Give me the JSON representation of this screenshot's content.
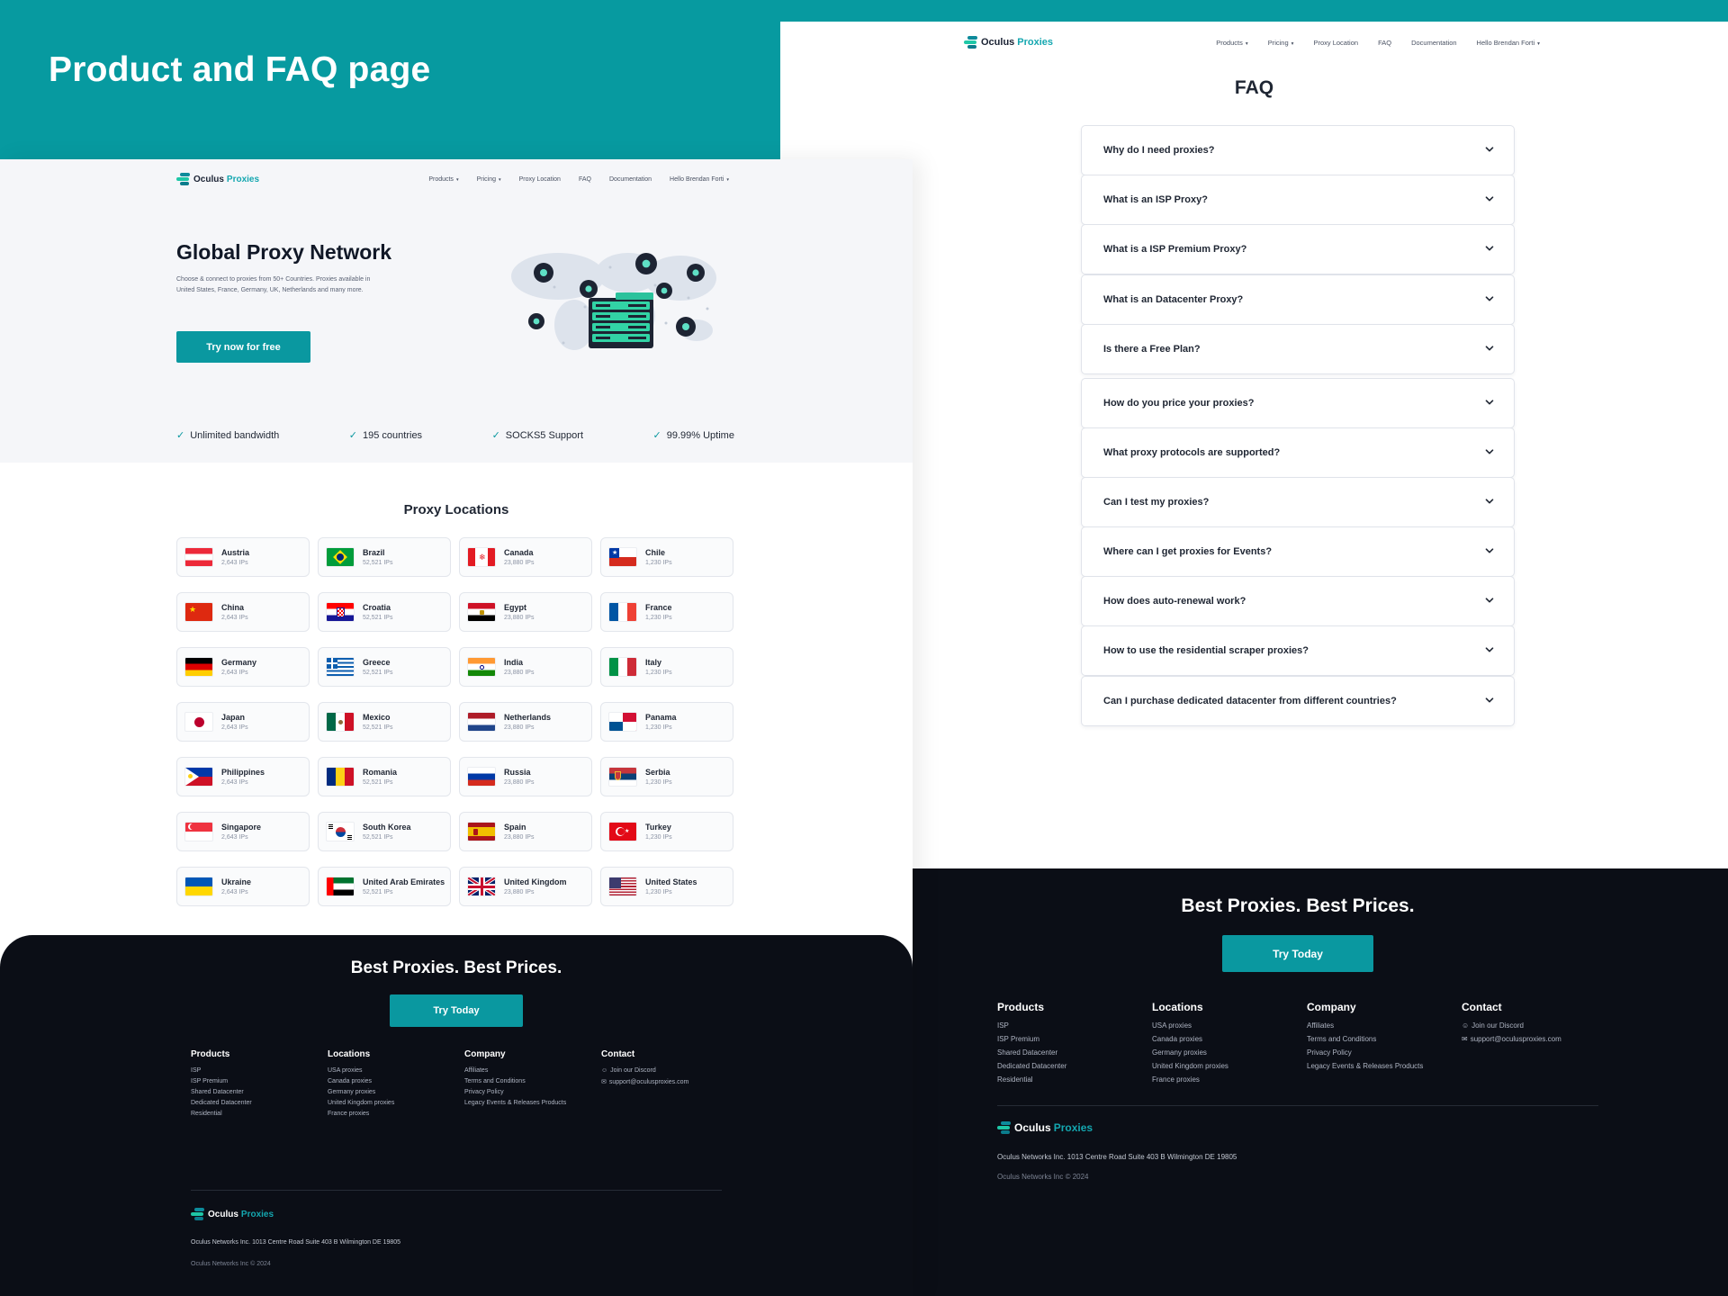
{
  "showcase_title": "Product and FAQ page",
  "colors": {
    "brand_teal": "#079aa0",
    "footer_dark": "#0b0e16",
    "hero_bg": "#f5f6f9"
  },
  "brand": {
    "word_a": "Oculus",
    "word_b": "Proxies"
  },
  "nav": {
    "items": [
      {
        "label": "Products",
        "dropdown": true
      },
      {
        "label": "Pricing",
        "dropdown": true
      },
      {
        "label": "Proxy Location",
        "dropdown": false
      },
      {
        "label": "FAQ",
        "dropdown": false
      },
      {
        "label": "Documentation",
        "dropdown": false
      },
      {
        "label": "Hello Brendan Forti",
        "dropdown": true
      }
    ]
  },
  "hero": {
    "title": "Global Proxy Network",
    "description": "Choose & connect to proxies from 50+ Countries. Proxies available in United States, France, Germany, UK, Netherlands and many more.",
    "cta": "Try now for free"
  },
  "features": [
    "Unlimited bandwidth",
    "195 countries",
    "SOCKS5 Support",
    "99.99% Uptime"
  ],
  "locations": {
    "title": "Proxy Locations",
    "items": [
      {
        "name": "Austria",
        "ips": "2,643 IPs",
        "flag": "austria"
      },
      {
        "name": "Brazil",
        "ips": "52,521 IPs",
        "flag": "brazil"
      },
      {
        "name": "Canada",
        "ips": "23,880 IPs",
        "flag": "canada"
      },
      {
        "name": "Chile",
        "ips": "1,230 IPs",
        "flag": "chile"
      },
      {
        "name": "China",
        "ips": "2,643 IPs",
        "flag": "china"
      },
      {
        "name": "Croatia",
        "ips": "52,521 IPs",
        "flag": "croatia"
      },
      {
        "name": "Egypt",
        "ips": "23,880 IPs",
        "flag": "egypt"
      },
      {
        "name": "France",
        "ips": "1,230 IPs",
        "flag": "france"
      },
      {
        "name": "Germany",
        "ips": "2,643 IPs",
        "flag": "germany"
      },
      {
        "name": "Greece",
        "ips": "52,521 IPs",
        "flag": "greece"
      },
      {
        "name": "India",
        "ips": "23,880 IPs",
        "flag": "india"
      },
      {
        "name": "Italy",
        "ips": "1,230 IPs",
        "flag": "italy"
      },
      {
        "name": "Japan",
        "ips": "2,643 IPs",
        "flag": "japan"
      },
      {
        "name": "Mexico",
        "ips": "52,521 IPs",
        "flag": "mexico"
      },
      {
        "name": "Netherlands",
        "ips": "23,880 IPs",
        "flag": "netherlands"
      },
      {
        "name": "Panama",
        "ips": "1,230 IPs",
        "flag": "panama"
      },
      {
        "name": "Philippines",
        "ips": "2,643 IPs",
        "flag": "philippines"
      },
      {
        "name": "Romania",
        "ips": "52,521 IPs",
        "flag": "romania"
      },
      {
        "name": "Russia",
        "ips": "23,880 IPs",
        "flag": "russia"
      },
      {
        "name": "Serbia",
        "ips": "1,230 IPs",
        "flag": "serbia"
      },
      {
        "name": "Singapore",
        "ips": "2,643 IPs",
        "flag": "singapore"
      },
      {
        "name": "South Korea",
        "ips": "52,521 IPs",
        "flag": "south-korea"
      },
      {
        "name": "Spain",
        "ips": "23,880 IPs",
        "flag": "spain"
      },
      {
        "name": "Turkey",
        "ips": "1,230 IPs",
        "flag": "turkey"
      },
      {
        "name": "Ukraine",
        "ips": "2,643 IPs",
        "flag": "ukraine"
      },
      {
        "name": "United Arab Emirates",
        "ips": "52,521 IPs",
        "flag": "uae"
      },
      {
        "name": "United Kingdom",
        "ips": "23,880 IPs",
        "flag": "uk"
      },
      {
        "name": "United States",
        "ips": "1,230 IPs",
        "flag": "usa"
      }
    ]
  },
  "faq": {
    "title": "FAQ",
    "items": [
      "Why do I need proxies?",
      "What is an ISP Proxy?",
      "What is a ISP Premium Proxy?",
      "What is an Datacenter Proxy?",
      "Is there a Free Plan?",
      "How do you price your proxies?",
      "What proxy protocols are supported?",
      "Can I test my proxies?",
      "Where can I get proxies for Events?",
      "How does auto-renewal work?",
      "How to use the residential scraper proxies?",
      "Can I purchase dedicated datacenter from different countries?"
    ]
  },
  "footer": {
    "title": "Best Proxies. Best Prices.",
    "cta": "Try Today",
    "columns": [
      {
        "heading": "Products",
        "items": [
          "ISP",
          "ISP Premium",
          "Shared Datacenter",
          "Dedicated Datacenter",
          "Residential"
        ]
      },
      {
        "heading": "Locations",
        "items": [
          "USA proxies",
          "Canada proxies",
          "Germany proxies",
          "United Kingdom proxies",
          "France proxies"
        ]
      },
      {
        "heading": "Company",
        "items": [
          "Affiliates",
          "Terms and Conditions",
          "Privacy Policy",
          "Legacy Events & Releases Products"
        ]
      }
    ],
    "contact": {
      "heading": "Contact",
      "items": [
        {
          "icon": "discord-icon",
          "label": "Join our Discord"
        },
        {
          "icon": "email-icon",
          "label": "support@oculusproxies.com"
        }
      ]
    },
    "address": "Oculus Networks Inc. 1013 Centre Road Suite 403 B Wilmington DE 19805",
    "copyright": "Oculus Networks Inc © 2024"
  }
}
